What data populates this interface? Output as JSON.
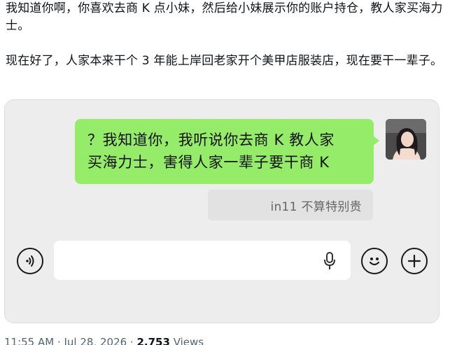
{
  "post": {
    "para1": "我知道你啊，你喜欢去商 K 点小妹，然后给小妹展示你的账户持仓，教人家买海力士。",
    "para2": "现在好了，人家本来干个 3 年能上岸回老家开个美甲店服装店，现在要干一辈子。"
  },
  "chat": {
    "message_line1": "？我知道你，我听说你去商 K 教人家",
    "message_line2": "买海力士，害得人家一辈子要干商 K",
    "caption": "in11 不算特别贵"
  },
  "input": {
    "voice_icon": "voice-icon",
    "mic_icon": "microphone-icon",
    "emoji_icon": "emoji-icon",
    "plus_icon": "plus-icon"
  },
  "meta": {
    "time": "11:55 AM · Jul 28, 2026 · ",
    "views_count": "2,753",
    "views_label": " Views"
  },
  "colors": {
    "bubble": "#95ec69",
    "chat_bg": "#ededed",
    "meta_gray": "#536471"
  }
}
